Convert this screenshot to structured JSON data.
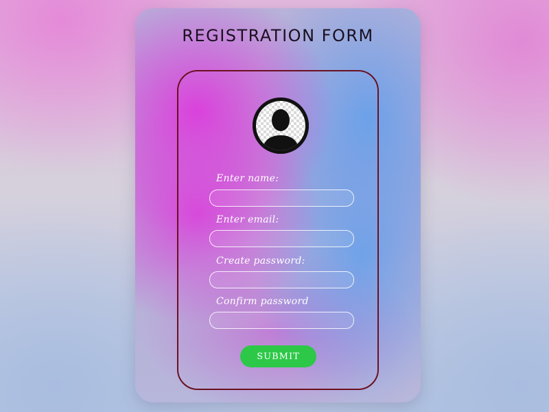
{
  "form": {
    "title": "REGISTRATION FORM",
    "avatar_icon": "user-avatar-icon",
    "fields": [
      {
        "label": "Enter name:",
        "value": "",
        "placeholder": ""
      },
      {
        "label": "Enter email:",
        "value": "",
        "placeholder": ""
      },
      {
        "label": "Create password:",
        "value": "",
        "placeholder": ""
      },
      {
        "label": "Confirm password",
        "value": "",
        "placeholder": ""
      }
    ],
    "submit_label": "SUBMIT"
  },
  "colors": {
    "submit_button": "#2dc848",
    "frame_border": "#6a1020",
    "accent_pink": "#d63adb",
    "accent_blue": "#66a3eb"
  }
}
